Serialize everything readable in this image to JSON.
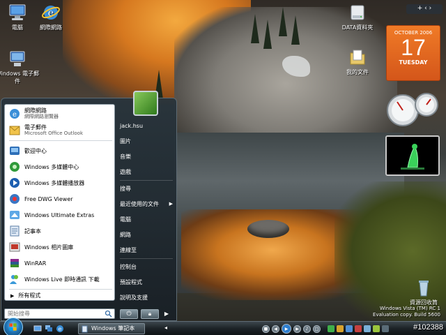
{
  "desktop": {
    "icons": {
      "computer": "電腦",
      "internet": "網際網路",
      "mail": "Windows 電子郵件",
      "data_drive": "DATA資料夾",
      "documents": "我的文件",
      "recycle_bin": "資源回收筒"
    },
    "watermark": {
      "line1": "Windows Vista (TM) RC 1",
      "line2": "Evaluation copy. Build 5600"
    },
    "post_id": "#102388"
  },
  "gadgets": {
    "sidebar_toggle": "+ ‹ ›",
    "calendar": {
      "month": "OCTOBER 2006",
      "day": "17",
      "weekday": "TUESDAY"
    }
  },
  "start_menu": {
    "user_name": "jack.hsu",
    "pinned": [
      {
        "label": "網際網路",
        "sub": "網際網路瀏覽器"
      },
      {
        "label": "電子郵件",
        "sub": "Microsoft Office Outlook"
      }
    ],
    "recent": [
      "歡迎中心",
      "Windows 多媒體中心",
      "Windows 多媒體播放器",
      "Free DWG Viewer",
      "Windows Ultimate Extras",
      "記事本",
      "Windows 相片圖庫",
      "WinRAR",
      "Windows Live 即時通訊 下載"
    ],
    "all_programs": "所有程式",
    "search_placeholder": "開始搜尋",
    "right": [
      "圖片",
      "音樂",
      "遊戲",
      "搜尋",
      "最近使用的文件",
      "電腦",
      "網路",
      "連線至",
      "控制台",
      "預設程式",
      "說明及支援"
    ]
  },
  "taskbar": {
    "running_task": "Windows 筆記本【..."
  },
  "colors": {
    "accent": "#2176b8",
    "calendar": "#e86a22",
    "taskbar": "#1d2327"
  }
}
